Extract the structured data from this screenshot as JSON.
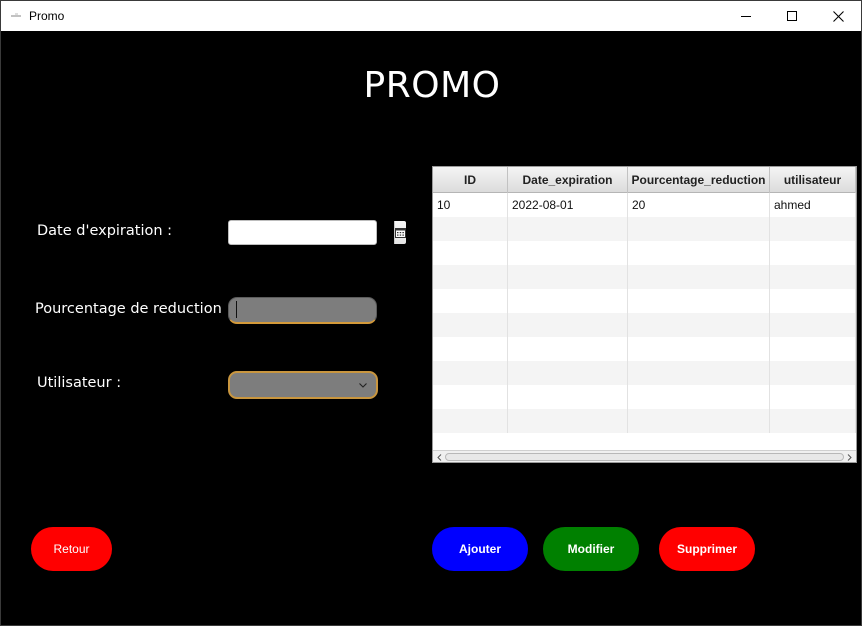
{
  "window": {
    "title": "Promo"
  },
  "page": {
    "heading": "PROMO"
  },
  "form": {
    "date_label": "Date d'expiration :",
    "date_value": "",
    "percent_label": "Pourcentage de reduction :",
    "percent_value": "",
    "user_label": "Utilisateur :",
    "user_selected": ""
  },
  "table": {
    "columns": [
      "ID",
      "Date_expiration",
      "Pourcentage_reduction",
      "utilisateur"
    ],
    "rows": [
      [
        "10",
        "2022-08-01",
        "20",
        "ahmed"
      ]
    ]
  },
  "buttons": {
    "retour": "Retour",
    "ajouter": "Ajouter",
    "modifier": "Modifier",
    "supprimer": "Supprimer"
  },
  "colors": {
    "background": "#000000",
    "retour": "#ff0000",
    "ajouter": "#0000ff",
    "modifier": "#008000",
    "supprimer": "#ff0000",
    "field_focus_border": "#c9963f"
  }
}
